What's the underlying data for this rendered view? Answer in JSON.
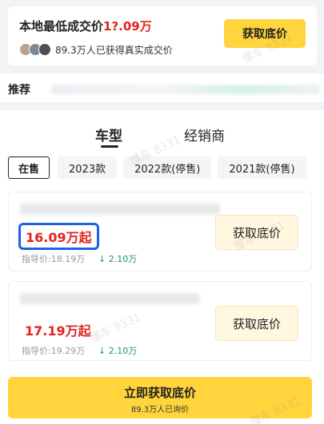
{
  "lowest_price": {
    "title_prefix": "本地最低成交价",
    "price": "1?.09万",
    "subtitle": "89.3万人已获得真实成交价",
    "button_label": "获取底价"
  },
  "recommend": {
    "label": "推荐"
  },
  "tabs": [
    {
      "label": "车型",
      "active": true
    },
    {
      "label": "经销商",
      "active": false
    }
  ],
  "years": [
    "在售",
    "2023款",
    "2022款(停售)",
    "2021款(停售)"
  ],
  "cars": [
    {
      "price": "16.09万起",
      "guide_price": "指导价:18.19万",
      "drop": "↓ 2.10万",
      "button_label": "获取底价",
      "highlighted": true
    },
    {
      "price": "17.19万起",
      "guide_price": "指导价:19.29万",
      "drop": "↓ 2.10万",
      "button_label": "获取底价",
      "highlighted": false
    }
  ],
  "bottom_cta": {
    "label": "立即获取底价",
    "subtitle": "89.3万人已询价"
  },
  "watermark": "懂车 8331",
  "colors": {
    "accent_yellow": "#ffd43c",
    "price_red": "#e0231d",
    "drop_green": "#1f9a5a",
    "highlight_blue": "#2060e8"
  }
}
